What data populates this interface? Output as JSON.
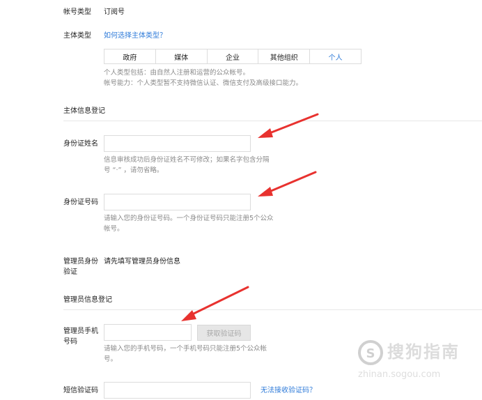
{
  "account_type": {
    "label": "帐号类型",
    "value": "订阅号"
  },
  "subject_type": {
    "label": "主体类型",
    "help_link": "如何选择主体类型？",
    "tabs": [
      {
        "label": "政府",
        "active": false
      },
      {
        "label": "媒体",
        "active": false
      },
      {
        "label": "企业",
        "active": false
      },
      {
        "label": "其他组织",
        "active": false
      },
      {
        "label": "个人",
        "active": true
      }
    ],
    "hints": [
      "个人类型包括：由自然人注册和运营的公众帐号。",
      "帐号能力：个人类型暂不支持微信认证、微信支付及高级接口能力。"
    ]
  },
  "subject_info": {
    "section_title": "主体信息登记",
    "id_name": {
      "label": "身份证姓名",
      "value": "",
      "hint_lines": [
        "信息审核成功后身份证姓名不可修改；如果名字包含分隔",
        "号 “·” ，请勿省略。"
      ]
    },
    "id_number": {
      "label": "身份证号码",
      "value": "",
      "hint_lines": [
        "请输入您的身份证号码。一个身份证号码只能注册5个公众",
        "帐号。"
      ]
    },
    "admin_verify": {
      "label_lines": [
        "管理员身份",
        "验证"
      ],
      "value": "请先填写管理员身份信息"
    }
  },
  "admin_info": {
    "section_title": "管理员信息登记",
    "phone": {
      "label_lines": [
        "管理员手机",
        "号码"
      ],
      "value": "",
      "get_code_button": "获取验证码",
      "hint_lines": [
        "请输入您的手机号码，一个手机号码只能注册5个公众帐",
        "号。"
      ]
    },
    "sms_code": {
      "label": "短信验证码",
      "value": "",
      "help_link": "无法接收验证码？"
    }
  },
  "watermark": {
    "text": "搜狗指南",
    "url_text": "zhinan.sogou.com"
  },
  "colors": {
    "accent": "#2f7bd9",
    "arrow": "#e8322f",
    "hint": "#8a8a8a"
  }
}
